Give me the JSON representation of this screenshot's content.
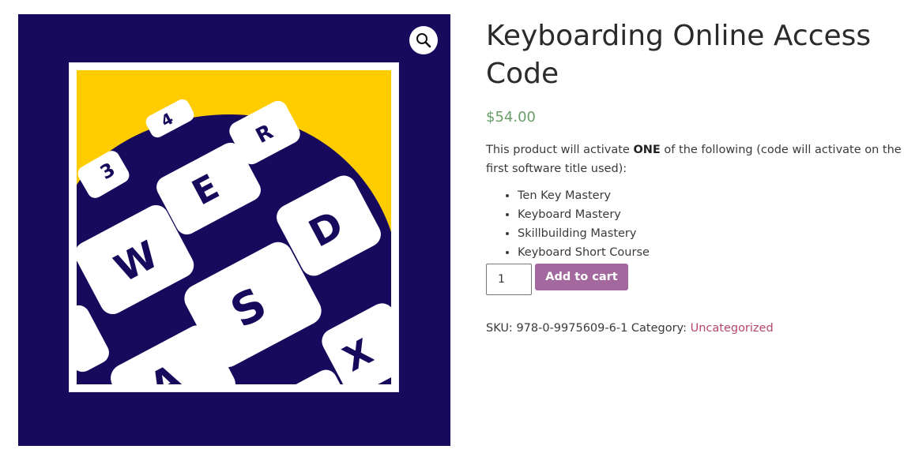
{
  "product": {
    "title": "Keyboarding Online Access Code",
    "price": "$54.00",
    "description": {
      "prefix": "This product will activate ",
      "emphasis": "ONE",
      "suffix": " of the following (code will activate on the first software title used):"
    },
    "features": [
      "Ten Key Mastery",
      "Keyboard Mastery",
      "Skillbuilding Mastery",
      "Keyboard Short Course"
    ],
    "quantity": "1",
    "add_to_cart_label": "Add to cart",
    "sku_label": "SKU:",
    "sku": "978-0-9975609-6-1",
    "category_label": "Category:",
    "category": "Uncategorized",
    "image": {
      "keys": [
        "3",
        "4",
        "R",
        "E",
        "W",
        "D",
        "S",
        "X",
        "A"
      ]
    }
  },
  "colors": {
    "gallery_bg": "#170a5c",
    "image_yellow": "#ffcc00",
    "price": "#6a9d6a",
    "button": "#a3689e",
    "link": "#b5466b"
  },
  "icons": {
    "zoom": "magnifier-icon"
  }
}
